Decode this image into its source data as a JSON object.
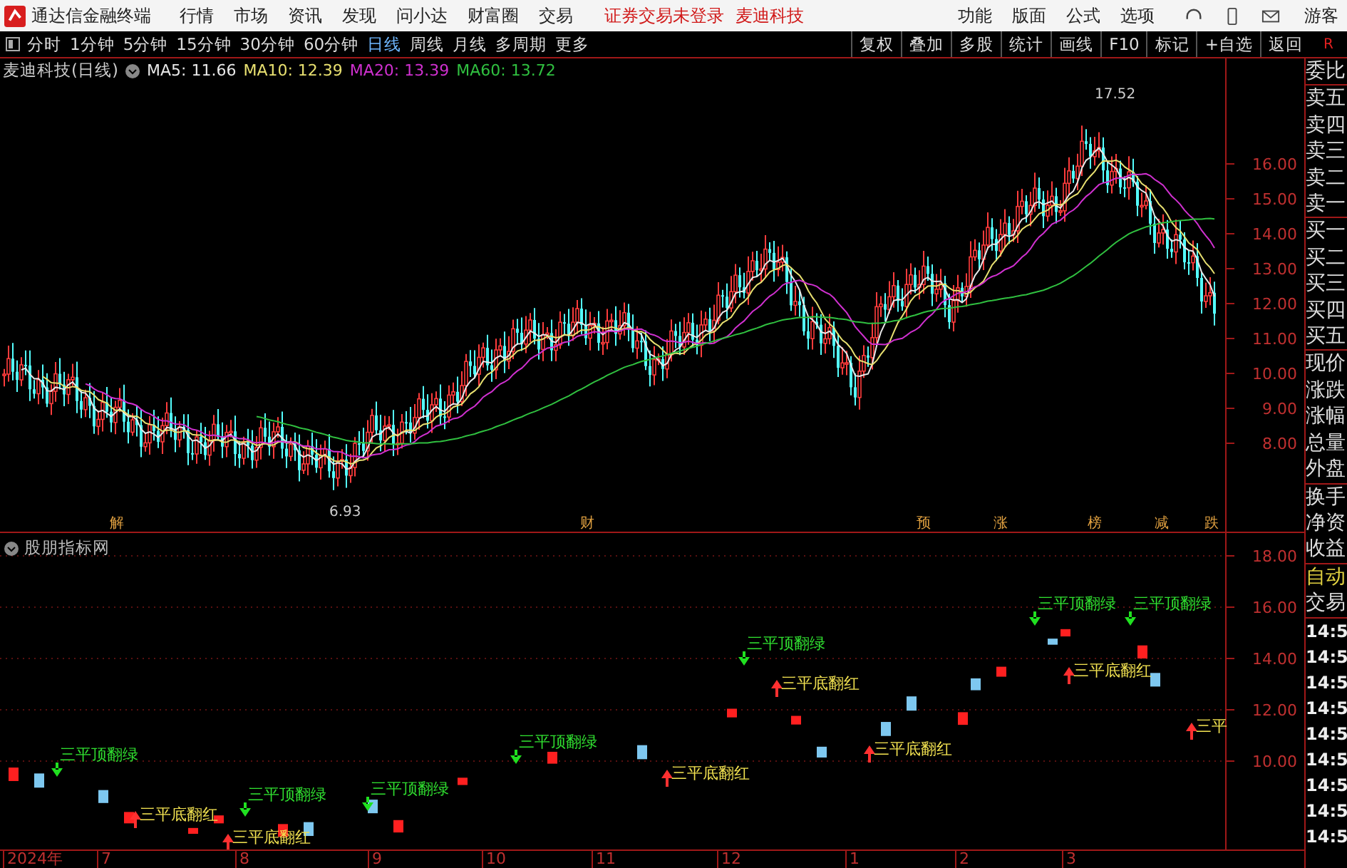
{
  "app": {
    "title": "通达信金融终端",
    "menu": [
      "行情",
      "市场",
      "资讯",
      "发现",
      "问小达",
      "财富圈",
      "交易"
    ],
    "notice": "证券交易未登录",
    "stock": "麦迪科技",
    "right_menu": [
      "功能",
      "版面",
      "公式",
      "选项"
    ],
    "user": "游客"
  },
  "toolbar": {
    "periods": [
      {
        "label": "分时",
        "selected": false
      },
      {
        "label": "1分钟",
        "selected": false
      },
      {
        "label": "5分钟",
        "selected": false
      },
      {
        "label": "15分钟",
        "selected": false
      },
      {
        "label": "30分钟",
        "selected": false
      },
      {
        "label": "60分钟",
        "selected": false
      },
      {
        "label": "日线",
        "selected": true
      },
      {
        "label": "周线",
        "selected": false
      },
      {
        "label": "月线",
        "selected": false
      },
      {
        "label": "多周期",
        "selected": false
      },
      {
        "label": "更多",
        "selected": false
      }
    ],
    "buttons": [
      "复权",
      "叠加",
      "多股",
      "统计",
      "画线",
      "F10",
      "标记",
      "+自选",
      "返回"
    ],
    "badge": "R"
  },
  "main_chart": {
    "title": "麦迪科技(日线)",
    "indicators": [
      {
        "label": "MA5: 11.66",
        "color": "#e8e8e8"
      },
      {
        "label": "MA10: 12.39",
        "color": "#e8e070"
      },
      {
        "label": "MA20: 13.39",
        "color": "#d030d0"
      },
      {
        "label": "MA60: 13.72",
        "color": "#30c040"
      }
    ],
    "yticks": [
      "16.00",
      "15.00",
      "14.00",
      "13.00",
      "12.00",
      "11.00",
      "10.00",
      "9.00",
      "8.00"
    ],
    "high_label": "17.52",
    "low_label": "6.93",
    "events": [
      "解",
      "财",
      "预",
      "涨",
      "榜",
      "减",
      "跌"
    ]
  },
  "indicator_panel": {
    "title": "股朋指标网",
    "yticks": [
      "18.00",
      "16.00",
      "14.00",
      "12.00",
      "10.00"
    ],
    "signals": [
      {
        "kind": "top",
        "label": "三平顶翻绿"
      },
      {
        "kind": "bottom",
        "label": "三平底翻红"
      },
      {
        "kind": "bottom",
        "label": "三平底翻红"
      },
      {
        "kind": "top",
        "label": "三平顶翻绿"
      },
      {
        "kind": "top",
        "label": "三平顶翻绿"
      },
      {
        "kind": "top",
        "label": "三平顶翻绿"
      },
      {
        "kind": "bottom",
        "label": "三平底翻红"
      },
      {
        "kind": "top",
        "label": "三平顶翻绿"
      },
      {
        "kind": "bottom",
        "label": "三平底翻红"
      },
      {
        "kind": "bottom",
        "label": "三平底翻红"
      },
      {
        "kind": "top",
        "label": "三平顶翻绿"
      },
      {
        "kind": "top",
        "label": "三平顶翻绿"
      },
      {
        "kind": "bottom",
        "label": "三平底翻红"
      },
      {
        "kind": "bottom",
        "label": "三平"
      }
    ]
  },
  "x_axis": [
    "2024年",
    "7",
    "8",
    "9",
    "10",
    "11",
    "12",
    "1",
    "2",
    "3"
  ],
  "right_panel": {
    "groups": [
      {
        "items": [
          "委比"
        ]
      },
      {
        "items": [
          "卖五",
          "卖四",
          "卖三",
          "卖二",
          "卖一"
        ]
      },
      {
        "items": [
          "买一",
          "买二",
          "买三",
          "买四",
          "买五"
        ]
      },
      {
        "items": [
          "现价",
          "涨跌",
          "涨幅",
          "总量",
          "外盘"
        ]
      },
      {
        "items": [
          "换手",
          "净资",
          "收益"
        ]
      }
    ],
    "mode": "自动",
    "trade": "交易",
    "times": [
      "14:5",
      "14:5",
      "14:5",
      "14:5",
      "14:5",
      "14:5",
      "14:5",
      "14:5",
      "14:5"
    ]
  }
}
